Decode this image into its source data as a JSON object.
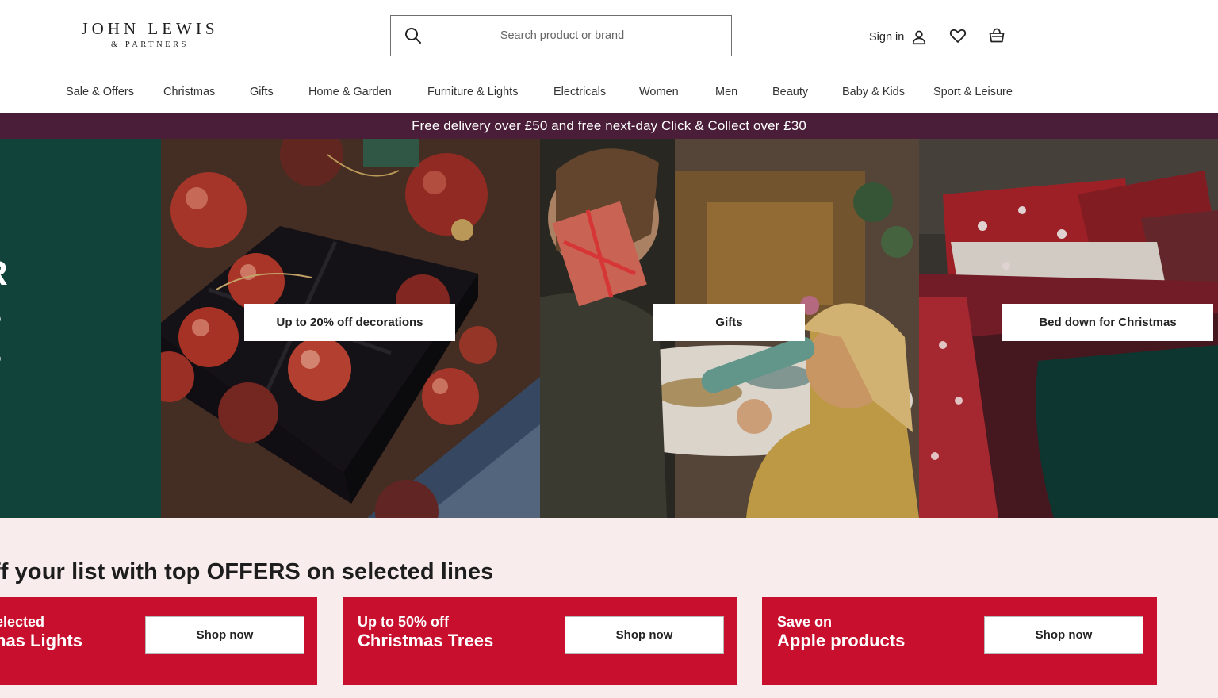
{
  "header": {
    "logo_line1": "JOHN LEWIS",
    "logo_line2": "& PARTNERS",
    "search_placeholder": "Search product or brand",
    "sign_in_label": "Sign in",
    "icons": [
      "search-icon",
      "user-icon",
      "heart-icon",
      "basket-icon"
    ]
  },
  "nav": {
    "items": [
      "Sale & Offers",
      "Christmas",
      "Gifts",
      "Home & Garden",
      "Furniture & Lights",
      "Electricals",
      "Women",
      "Men",
      "Beauty",
      "Baby & Kids",
      "Sport & Leisure"
    ]
  },
  "promo_bar": {
    "text": "Free delivery over £50 and free next-day Click & Collect over £30"
  },
  "hero": {
    "cropped_heading": "R\ns\ns",
    "tiles": [
      {
        "label": "Up to 20% off decorations"
      },
      {
        "label": "Gifts"
      },
      {
        "label": "Bed down for Christmas"
      }
    ]
  },
  "offers": {
    "title": "ff your list with top OFFERS on selected lines",
    "cards": [
      {
        "line1": "elected",
        "line2": "nas Lights",
        "button": "Shop now"
      },
      {
        "line1": "Up to 50% off",
        "line2": "Christmas Trees",
        "button": "Shop now"
      },
      {
        "line1": "Save on",
        "line2": "Apple products",
        "button": "Shop now"
      }
    ]
  },
  "colors": {
    "promo_bar": "#4a1d38",
    "hero_green": "#12433a",
    "offer_red": "#c8102e",
    "offers_bg": "#f8ecec"
  }
}
